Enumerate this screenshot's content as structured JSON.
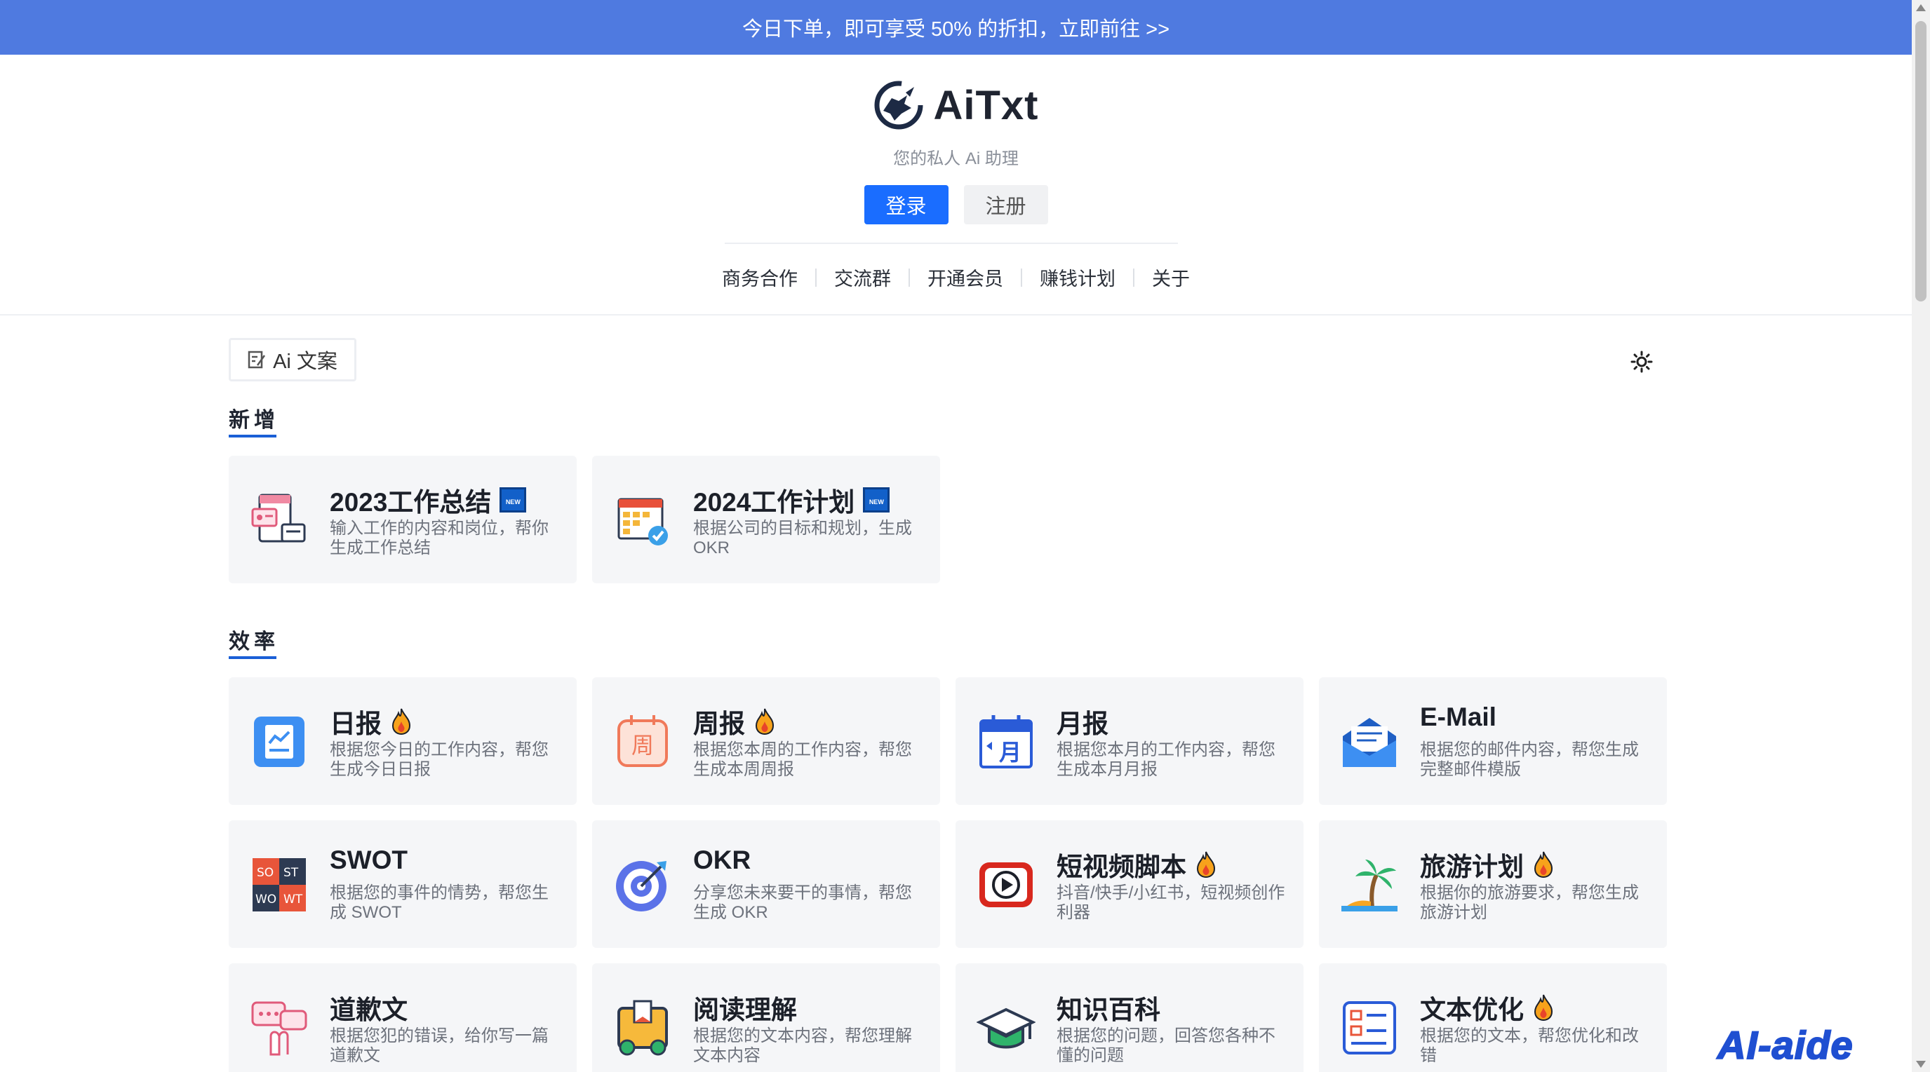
{
  "banner": {
    "text": "今日下单，即可享受 50% 的折扣，立即前往 >>"
  },
  "header": {
    "logo_text": "AiTxt",
    "tagline": "您的私人 Ai 助理",
    "login_label": "登录",
    "register_label": "注册",
    "nav": [
      "商务合作",
      "交流群",
      "开通会员",
      "赚钱计划",
      "关于"
    ]
  },
  "toolbar": {
    "tag_label": "Ai 文案",
    "theme_icon": "sun-icon"
  },
  "sections": [
    {
      "title": "新增",
      "cards": [
        {
          "title": "2023工作总结",
          "desc": "输入工作的内容和岗位，帮你生成工作总结",
          "badge": "NEW",
          "icon": "report-summary-icon"
        },
        {
          "title": "2024工作计划",
          "desc": "根据公司的目标和规划，生成 OKR",
          "badge": "NEW",
          "icon": "calendar-plan-icon"
        }
      ]
    },
    {
      "title": "效率",
      "cards": [
        {
          "title": "日报",
          "desc": "根据您今日的工作内容，帮您生成今日日报",
          "hot": true,
          "icon": "daily-report-icon"
        },
        {
          "title": "周报",
          "desc": "根据您本周的工作内容，帮您生成本周周报",
          "hot": true,
          "icon": "weekly-report-icon"
        },
        {
          "title": "月报",
          "desc": "根据您本月的工作内容，帮您生成本月月报",
          "hot": false,
          "icon": "monthly-report-icon"
        },
        {
          "title": "E-Mail",
          "desc": "根据您的邮件内容，帮您生成完整邮件模版",
          "hot": false,
          "icon": "email-icon"
        },
        {
          "title": "SWOT",
          "desc": "根据您的事件的情势，帮您生成 SWOT",
          "hot": false,
          "icon": "swot-icon"
        },
        {
          "title": "OKR",
          "desc": "分享您未来要干的事情，帮您生成 OKR",
          "hot": false,
          "icon": "okr-target-icon"
        },
        {
          "title": "短视频脚本",
          "desc": "抖音/快手/小红书，短视频创作利器",
          "hot": true,
          "icon": "video-play-icon"
        },
        {
          "title": "旅游计划",
          "desc": "根据你的旅游要求，帮您生成旅游计划",
          "hot": true,
          "icon": "palm-beach-icon"
        },
        {
          "title": "道歉文",
          "desc": "根据您犯的错误，给你写一篇道歉文",
          "hot": false,
          "icon": "apology-icon"
        },
        {
          "title": "阅读理解",
          "desc": "根据您的文本内容，帮您理解文本内容",
          "hot": false,
          "icon": "reading-icon"
        },
        {
          "title": "知识百科",
          "desc": "根据您的问题，回答您各种不懂的问题",
          "hot": false,
          "icon": "graduation-cap-icon"
        },
        {
          "title": "文本优化",
          "desc": "根据您的文本，帮您优化和改错",
          "hot": true,
          "icon": "text-optimize-icon"
        }
      ]
    }
  ],
  "watermark": "AI-aide"
}
